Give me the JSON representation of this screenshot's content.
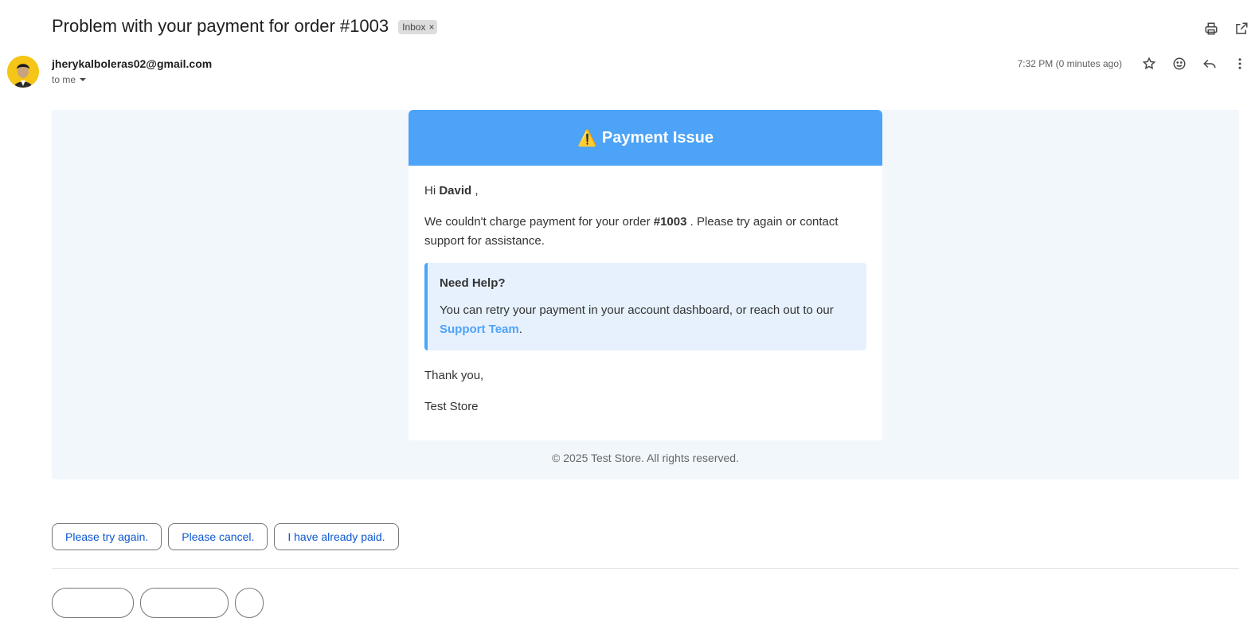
{
  "email": {
    "subject": "Problem with your payment for order #1003",
    "label": "Inbox",
    "label_remove": "×",
    "sender": "jherykalboleras02@gmail.com",
    "recipient": "to me",
    "time": "7:32 PM (0 minutes ago)"
  },
  "body": {
    "header_icon": "⚠️",
    "header_title": "Payment Issue",
    "greeting_prefix": "Hi ",
    "customer_name": "David",
    "greeting_suffix": " ,",
    "message_prefix": "We couldn't charge payment for your order ",
    "order_number": "#1003",
    "message_suffix": " . Please try again or contact support for assistance.",
    "help_title": "Need Help?",
    "help_text": "You can retry your payment in your account dashboard, or reach out to our ",
    "help_link": "Support Team",
    "help_end": ".",
    "thanks": "Thank you,",
    "signature": "Test Store",
    "footer": "© 2025 Test Store. All rights reserved."
  },
  "smart_replies": [
    "Please try again.",
    "Please cancel.",
    "I have already paid."
  ],
  "icons": [
    "print-icon",
    "open-in-new-window-icon",
    "star-icon",
    "emoji-icon",
    "reply-icon",
    "more-vert-icon",
    "chevron-down-icon",
    "warning-icon"
  ],
  "colors": {
    "header_blue": "#4da3f7",
    "background": "#f2f7fc",
    "help_box": "#e6f1fd",
    "link_blue": "#0b57d0"
  }
}
